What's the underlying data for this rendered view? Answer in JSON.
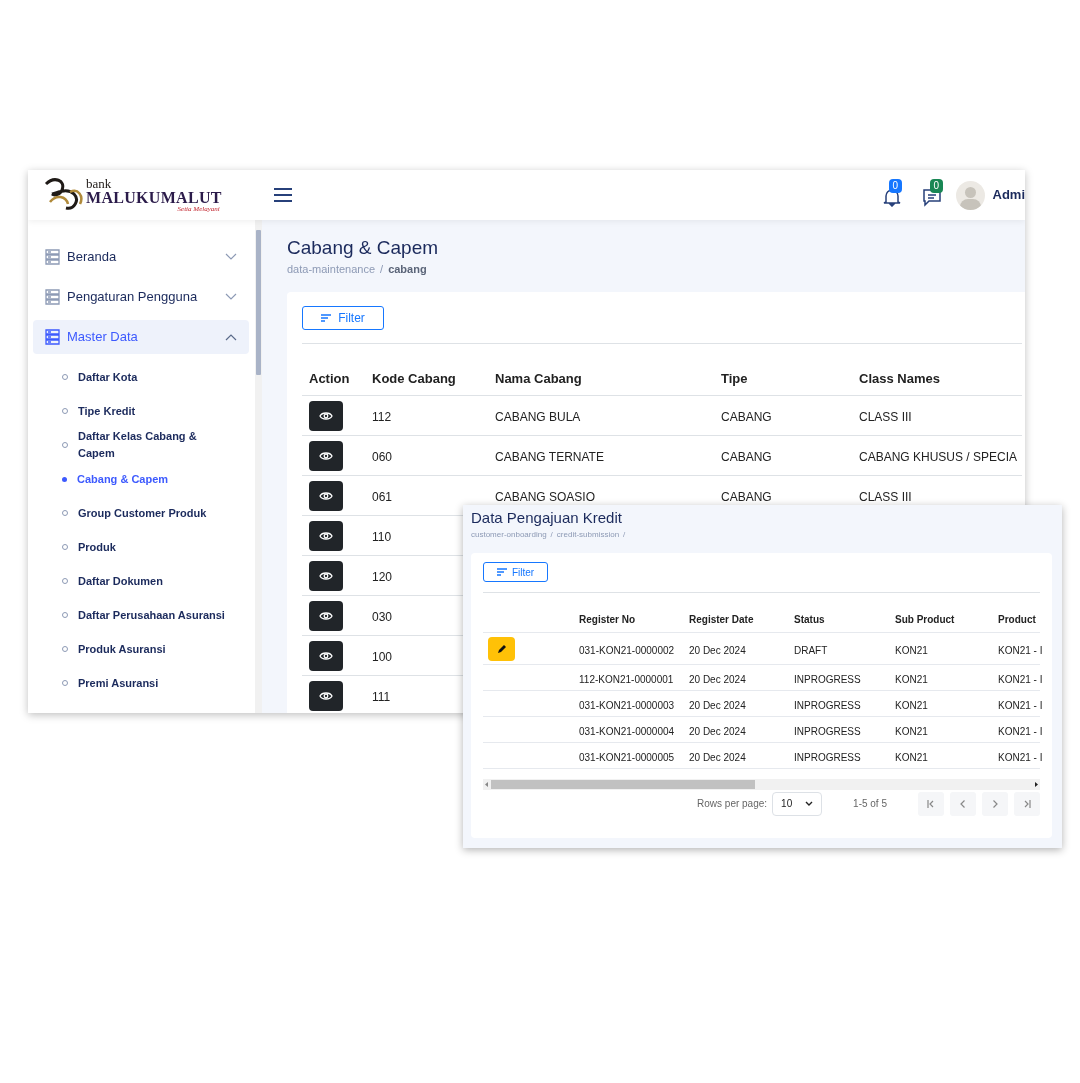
{
  "header": {
    "logo": {
      "bank": "bank",
      "name": "MALUKUMALUT",
      "tagline": "Setia Melayani"
    },
    "notifications": {
      "count": "0"
    },
    "messages": {
      "count": "0"
    },
    "user": {
      "name": "Admi"
    }
  },
  "sidebar": {
    "items": [
      {
        "label": "Beranda",
        "expanded": false,
        "selected": false
      },
      {
        "label": "Pengaturan Pengguna",
        "expanded": false,
        "selected": false
      },
      {
        "label": "Master Data",
        "expanded": true,
        "selected": true,
        "children": [
          {
            "label": "Daftar Kota",
            "selected": false
          },
          {
            "label": "Tipe Kredit",
            "selected": false
          },
          {
            "label": "Daftar Kelas Cabang & Capem",
            "selected": false
          },
          {
            "label": "Cabang & Capem",
            "selected": true
          },
          {
            "label": "Group Customer Produk",
            "selected": false
          },
          {
            "label": "Produk",
            "selected": false
          },
          {
            "label": "Daftar Dokumen",
            "selected": false
          },
          {
            "label": "Daftar Perusahaan Asuransi",
            "selected": false
          },
          {
            "label": "Produk Asuransi",
            "selected": false
          },
          {
            "label": "Premi Asuransi",
            "selected": false
          }
        ]
      }
    ]
  },
  "page": {
    "title": "Cabang & Capem",
    "breadcrumb": [
      {
        "text": "data-maintenance",
        "current": false
      },
      {
        "text": "/",
        "current": false
      },
      {
        "text": "cabang",
        "current": true
      }
    ],
    "filter_button": "Filter",
    "table": {
      "columns": [
        "Action",
        "Kode Cabang",
        "Nama Cabang",
        "Tipe",
        "Class Names"
      ],
      "rows": [
        [
          "",
          "112",
          "CABANG BULA",
          "CABANG",
          "CLASS III"
        ],
        [
          "",
          "060",
          "CABANG TERNATE",
          "CABANG",
          "CABANG KHUSUS / SPECIA"
        ],
        [
          "",
          "061",
          "CABANG SOASIO",
          "CABANG",
          "CLASS III"
        ],
        [
          "",
          "110"
        ],
        [
          "",
          "120"
        ],
        [
          "",
          "030"
        ],
        [
          "",
          "100"
        ],
        [
          "",
          "111"
        ]
      ]
    }
  },
  "popup": {
    "title": "Data Pengajuan Kredit",
    "breadcrumb": [
      {
        "text": "customer-onboarding",
        "current": false
      },
      {
        "text": "/",
        "current": false
      },
      {
        "text": "credit-submission",
        "current": false
      },
      {
        "text": "/",
        "current": false
      }
    ],
    "filter_button": "Filter",
    "table": {
      "columns": [
        "Register No",
        "Register Date",
        "Status",
        "Sub Product",
        "Product"
      ],
      "rows": [
        {
          "editable": true,
          "cells": [
            "031-KON21-0000002",
            "20 Dec 2024",
            "DRAFT",
            "KON21",
            "KON21 - I"
          ]
        },
        {
          "editable": false,
          "cells": [
            "112-KON21-0000001",
            "20 Dec 2024",
            "INPROGRESS",
            "KON21",
            "KON21 - I"
          ]
        },
        {
          "editable": false,
          "cells": [
            "031-KON21-0000003",
            "20 Dec 2024",
            "INPROGRESS",
            "KON21",
            "KON21 - I"
          ]
        },
        {
          "editable": false,
          "cells": [
            "031-KON21-0000004",
            "20 Dec 2024",
            "INPROGRESS",
            "KON21",
            "KON21 - I"
          ]
        },
        {
          "editable": false,
          "cells": [
            "031-KON21-0000005",
            "20 Dec 2024",
            "INPROGRESS",
            "KON21",
            "KON21 - I"
          ]
        }
      ]
    },
    "pagination": {
      "rows_per_page_label": "Rows per page:",
      "rows_per_page": "10",
      "range": "1-5 of 5"
    }
  }
}
